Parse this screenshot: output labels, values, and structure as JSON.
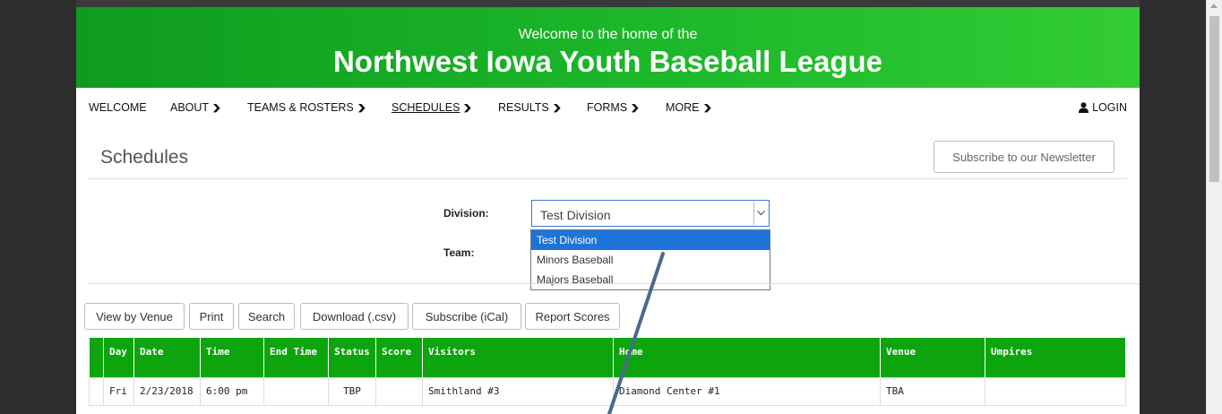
{
  "banner": {
    "subtitle": "Welcome to the home of the",
    "title": "Northwest Iowa Youth Baseball League"
  },
  "nav": {
    "items": [
      {
        "label": "WELCOME"
      },
      {
        "label": "ABOUT"
      },
      {
        "label": "TEAMS & ROSTERS"
      },
      {
        "label": "SCHEDULES"
      },
      {
        "label": "RESULTS"
      },
      {
        "label": "FORMS"
      },
      {
        "label": "MORE"
      }
    ],
    "active": "SCHEDULES",
    "login": "LOGIN"
  },
  "page": {
    "heading": "Schedules",
    "newsletter_button": "Subscribe to our Newsletter"
  },
  "filters": {
    "division_label": "Division:",
    "team_label": "Team:",
    "division_value": "Test Division",
    "division_options": [
      "Test Division",
      "Minors Baseball",
      "Majors Baseball"
    ]
  },
  "toolbar": {
    "buttons": [
      "View by Venue",
      "Print",
      "Search",
      "Download (.csv)",
      "Subscribe (iCal)",
      "Report Scores"
    ]
  },
  "table": {
    "headers": [
      "Day",
      "Date",
      "Time",
      "End Time",
      "Status",
      "Score",
      "Visitors",
      "Home",
      "Venue",
      "Umpires"
    ],
    "rows": [
      [
        "Fri",
        "2/23/2018",
        "6:00 pm",
        "",
        "TBP",
        "",
        "Smithland #3",
        "Diamond Center #1",
        "TBA",
        ""
      ]
    ]
  },
  "colors": {
    "banner_green": "#1cb82a",
    "table_header_green": "#0da50d",
    "selected_option": "#1e73d9",
    "annotation_arrow": "#4a6a8c"
  }
}
